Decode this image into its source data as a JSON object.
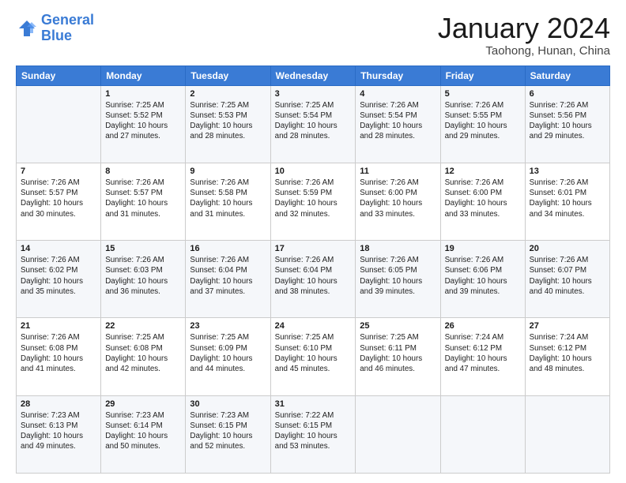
{
  "header": {
    "logo_line1": "General",
    "logo_line2": "Blue",
    "month_title": "January 2024",
    "location": "Taohong, Hunan, China"
  },
  "days_of_week": [
    "Sunday",
    "Monday",
    "Tuesday",
    "Wednesday",
    "Thursday",
    "Friday",
    "Saturday"
  ],
  "weeks": [
    [
      {
        "num": "",
        "info": ""
      },
      {
        "num": "1",
        "info": "Sunrise: 7:25 AM\nSunset: 5:52 PM\nDaylight: 10 hours\nand 27 minutes."
      },
      {
        "num": "2",
        "info": "Sunrise: 7:25 AM\nSunset: 5:53 PM\nDaylight: 10 hours\nand 28 minutes."
      },
      {
        "num": "3",
        "info": "Sunrise: 7:25 AM\nSunset: 5:54 PM\nDaylight: 10 hours\nand 28 minutes."
      },
      {
        "num": "4",
        "info": "Sunrise: 7:26 AM\nSunset: 5:54 PM\nDaylight: 10 hours\nand 28 minutes."
      },
      {
        "num": "5",
        "info": "Sunrise: 7:26 AM\nSunset: 5:55 PM\nDaylight: 10 hours\nand 29 minutes."
      },
      {
        "num": "6",
        "info": "Sunrise: 7:26 AM\nSunset: 5:56 PM\nDaylight: 10 hours\nand 29 minutes."
      }
    ],
    [
      {
        "num": "7",
        "info": "Sunrise: 7:26 AM\nSunset: 5:57 PM\nDaylight: 10 hours\nand 30 minutes."
      },
      {
        "num": "8",
        "info": "Sunrise: 7:26 AM\nSunset: 5:57 PM\nDaylight: 10 hours\nand 31 minutes."
      },
      {
        "num": "9",
        "info": "Sunrise: 7:26 AM\nSunset: 5:58 PM\nDaylight: 10 hours\nand 31 minutes."
      },
      {
        "num": "10",
        "info": "Sunrise: 7:26 AM\nSunset: 5:59 PM\nDaylight: 10 hours\nand 32 minutes."
      },
      {
        "num": "11",
        "info": "Sunrise: 7:26 AM\nSunset: 6:00 PM\nDaylight: 10 hours\nand 33 minutes."
      },
      {
        "num": "12",
        "info": "Sunrise: 7:26 AM\nSunset: 6:00 PM\nDaylight: 10 hours\nand 33 minutes."
      },
      {
        "num": "13",
        "info": "Sunrise: 7:26 AM\nSunset: 6:01 PM\nDaylight: 10 hours\nand 34 minutes."
      }
    ],
    [
      {
        "num": "14",
        "info": "Sunrise: 7:26 AM\nSunset: 6:02 PM\nDaylight: 10 hours\nand 35 minutes."
      },
      {
        "num": "15",
        "info": "Sunrise: 7:26 AM\nSunset: 6:03 PM\nDaylight: 10 hours\nand 36 minutes."
      },
      {
        "num": "16",
        "info": "Sunrise: 7:26 AM\nSunset: 6:04 PM\nDaylight: 10 hours\nand 37 minutes."
      },
      {
        "num": "17",
        "info": "Sunrise: 7:26 AM\nSunset: 6:04 PM\nDaylight: 10 hours\nand 38 minutes."
      },
      {
        "num": "18",
        "info": "Sunrise: 7:26 AM\nSunset: 6:05 PM\nDaylight: 10 hours\nand 39 minutes."
      },
      {
        "num": "19",
        "info": "Sunrise: 7:26 AM\nSunset: 6:06 PM\nDaylight: 10 hours\nand 39 minutes."
      },
      {
        "num": "20",
        "info": "Sunrise: 7:26 AM\nSunset: 6:07 PM\nDaylight: 10 hours\nand 40 minutes."
      }
    ],
    [
      {
        "num": "21",
        "info": "Sunrise: 7:26 AM\nSunset: 6:08 PM\nDaylight: 10 hours\nand 41 minutes."
      },
      {
        "num": "22",
        "info": "Sunrise: 7:25 AM\nSunset: 6:08 PM\nDaylight: 10 hours\nand 42 minutes."
      },
      {
        "num": "23",
        "info": "Sunrise: 7:25 AM\nSunset: 6:09 PM\nDaylight: 10 hours\nand 44 minutes."
      },
      {
        "num": "24",
        "info": "Sunrise: 7:25 AM\nSunset: 6:10 PM\nDaylight: 10 hours\nand 45 minutes."
      },
      {
        "num": "25",
        "info": "Sunrise: 7:25 AM\nSunset: 6:11 PM\nDaylight: 10 hours\nand 46 minutes."
      },
      {
        "num": "26",
        "info": "Sunrise: 7:24 AM\nSunset: 6:12 PM\nDaylight: 10 hours\nand 47 minutes."
      },
      {
        "num": "27",
        "info": "Sunrise: 7:24 AM\nSunset: 6:12 PM\nDaylight: 10 hours\nand 48 minutes."
      }
    ],
    [
      {
        "num": "28",
        "info": "Sunrise: 7:23 AM\nSunset: 6:13 PM\nDaylight: 10 hours\nand 49 minutes."
      },
      {
        "num": "29",
        "info": "Sunrise: 7:23 AM\nSunset: 6:14 PM\nDaylight: 10 hours\nand 50 minutes."
      },
      {
        "num": "30",
        "info": "Sunrise: 7:23 AM\nSunset: 6:15 PM\nDaylight: 10 hours\nand 52 minutes."
      },
      {
        "num": "31",
        "info": "Sunrise: 7:22 AM\nSunset: 6:15 PM\nDaylight: 10 hours\nand 53 minutes."
      },
      {
        "num": "",
        "info": ""
      },
      {
        "num": "",
        "info": ""
      },
      {
        "num": "",
        "info": ""
      }
    ]
  ]
}
